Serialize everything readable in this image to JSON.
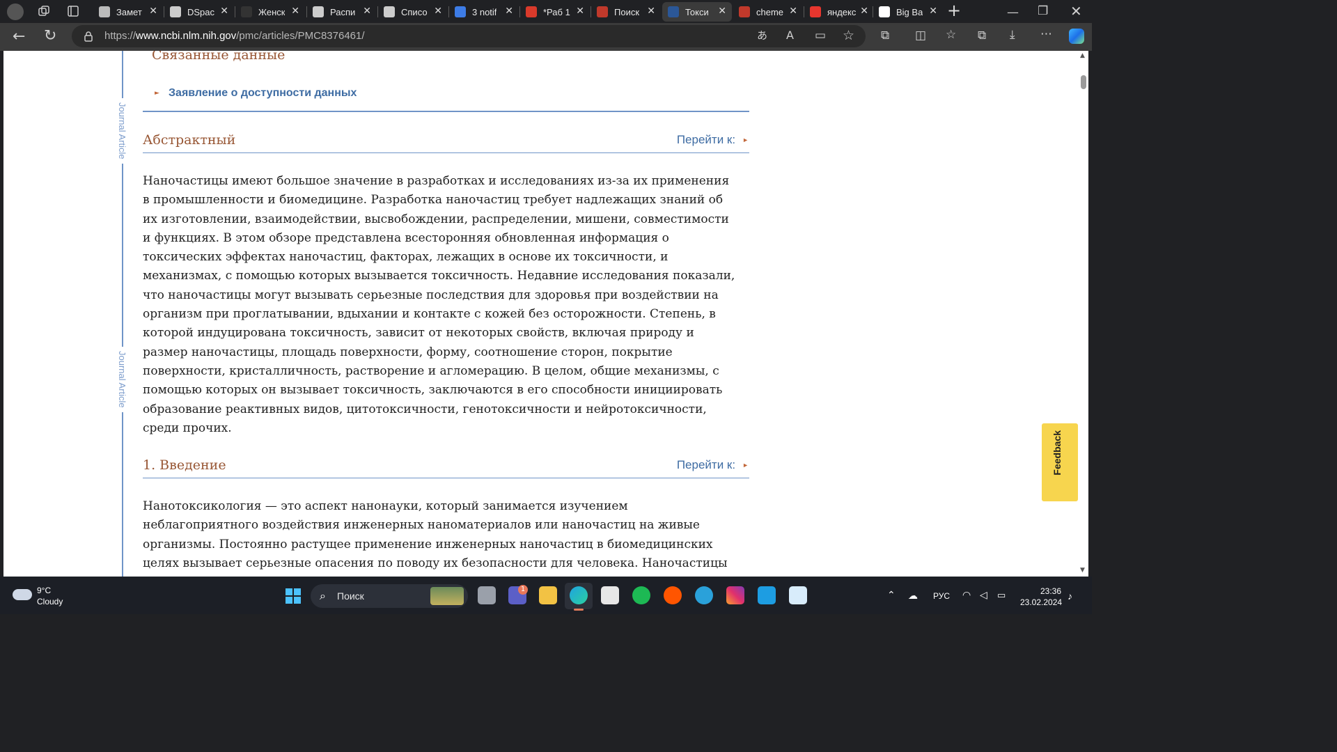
{
  "browser": {
    "tabs": [
      {
        "title": "Замет",
        "icon": "apple-icon",
        "color": "#bbbbbb"
      },
      {
        "title": "DSpac",
        "icon": "page-icon",
        "color": "#cccccc"
      },
      {
        "title": "Женск",
        "icon": "fa-icon",
        "color": "#333333"
      },
      {
        "title": "Распи",
        "icon": "page-icon",
        "color": "#cccccc"
      },
      {
        "title": "Списо",
        "icon": "page-icon",
        "color": "#cccccc"
      },
      {
        "title": "3 notif",
        "icon": "badge-3-icon",
        "color": "#3d7ce6"
      },
      {
        "title": "*Раб 1",
        "icon": "pdf-icon",
        "color": "#d93a2b"
      },
      {
        "title": "Поиск",
        "icon": "c-logo-icon",
        "color": "#c0392b"
      },
      {
        "title": "Токси",
        "icon": "ncbi-icon",
        "color": "#2b5797",
        "active": true
      },
      {
        "title": "cheme",
        "icon": "c-logo-icon",
        "color": "#c0392b"
      },
      {
        "title": "яндекс",
        "icon": "yandex-icon",
        "color": "#e7362e"
      },
      {
        "title": "Big Ba",
        "icon": "bigba-icon",
        "color": "#ffffff"
      }
    ],
    "new_tab": "+",
    "url_prefix": "https://",
    "url_host": "www.ncbi.nlm.nih.gov",
    "url_path": "/pmc/articles/PMC8376461/"
  },
  "article": {
    "side_label": "Journal Article",
    "related_heading": "Связанные данные",
    "data_statement_link": "Заявление о доступности данных",
    "jump_label": "Перейти к:",
    "abstract": {
      "heading": "Абстрактный",
      "lines": [
        "Наночастицы имеют большое значение в разработках и исследованиях из-за их применения",
        "в промышленности и биомедицине. Разработка наночастиц требует надлежащих знаний об",
        "их изготовлении, взаимодействии, высвобождении, распределении, мишени, совместимости",
        "и функциях. В этом обзоре представлена всесторонняя обновленная информация о",
        "токсических эффектах наночастиц, факторах, лежащих в основе их токсичности, и",
        "механизмах, с помощью которых вызывается токсичность. Недавние исследования показали,",
        "что наночастицы могут вызывать серьезные последствия для здоровья при воздействии на",
        "организм при проглатывании, вдыхании и контакте с кожей без осторожности. Степень, в",
        "которой индуцирована токсичность, зависит от некоторых свойств, включая природу и",
        "размер наночастицы, площадь поверхности, форму, соотношение сторон, покрытие",
        "поверхности, кристалличность, растворение и агломерацию. В целом, общие механизмы, с",
        "помощью которых он вызывает токсичность, заключаются в его способности инициировать",
        "образование реактивных видов, цитотоксичности, генотоксичности и нейротоксичности,",
        "среди прочих."
      ]
    },
    "intro": {
      "heading": "1. Введение",
      "lines": [
        "Нанотоксикология — это аспект нанонауки, который занимается изучением",
        "неблагоприятного воздействия инженерных наноматериалов или наночастиц на живые",
        "организмы. Постоянно растущее применение инженерных наночастиц в биомедицинских",
        "целях вызывает серьезные опасения по поводу их безопасности для человека. Наночастицы"
      ]
    },
    "feedback_label": "Feedback"
  },
  "taskbar": {
    "weather_temp": "9°C",
    "weather_desc": "Cloudy",
    "search_placeholder": "Поиск",
    "teams_badge": "1",
    "lang": "РУС",
    "time": "23:36",
    "date": "23.02.2024"
  }
}
